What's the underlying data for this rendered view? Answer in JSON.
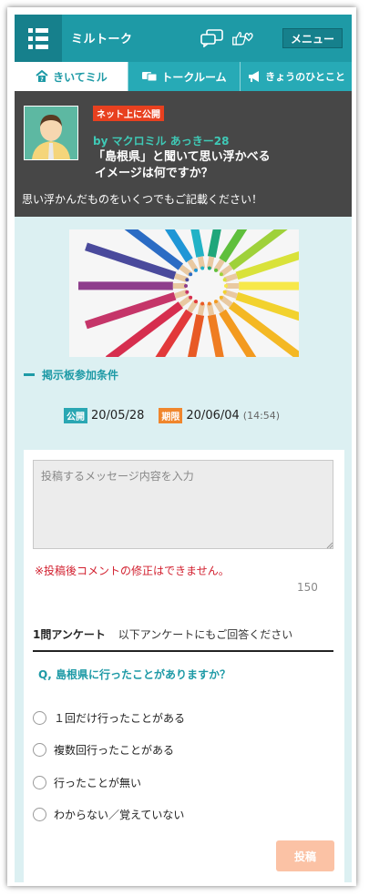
{
  "header": {
    "logo": "ミルトーク",
    "menu_label": "メニュー"
  },
  "tabs": [
    {
      "label": "きいてミル",
      "icon": "question-house-icon",
      "active": true
    },
    {
      "label": "トークルーム",
      "icon": "chat-bubbles-icon",
      "active": false
    },
    {
      "label": "きょうのひとこと",
      "icon": "megaphone-icon",
      "active": false
    }
  ],
  "topic": {
    "badge": "ネット上に公開",
    "byline": "by マクロミル あっきー28",
    "question_line1": "「島根県」と聞いて思い浮かべる",
    "question_line2": "イメージは何ですか？",
    "prompt": "思い浮かんだものをいくつでもご記載ください！"
  },
  "conditions_label": "掲示板参加条件",
  "dates": {
    "public_tag": "公開",
    "public_date": "20/05/28",
    "limit_tag": "期限",
    "limit_date": "20/06/04",
    "limit_time": "(14:54)"
  },
  "form": {
    "placeholder": "投稿するメッセージ内容を入力",
    "warning": "※投稿後コメントの修正はできません。",
    "char_count": "150",
    "survey_title": "1問アンケート",
    "survey_subtitle": "以下アンケートにもご回答ください",
    "question": "Q, 島根県に行ったことがありますか？",
    "options": [
      "１回だけ行ったことがある",
      "複数回行ったことがある",
      "行ったことが無い",
      "わからない／覚えていない"
    ],
    "submit_label": "投稿"
  },
  "colors": {
    "brand": "#1e9aa6",
    "topic_bg": "#474747",
    "page_bg": "#dcf0f2",
    "warning": "#d21f2e",
    "submit": "#fbc2a5"
  }
}
